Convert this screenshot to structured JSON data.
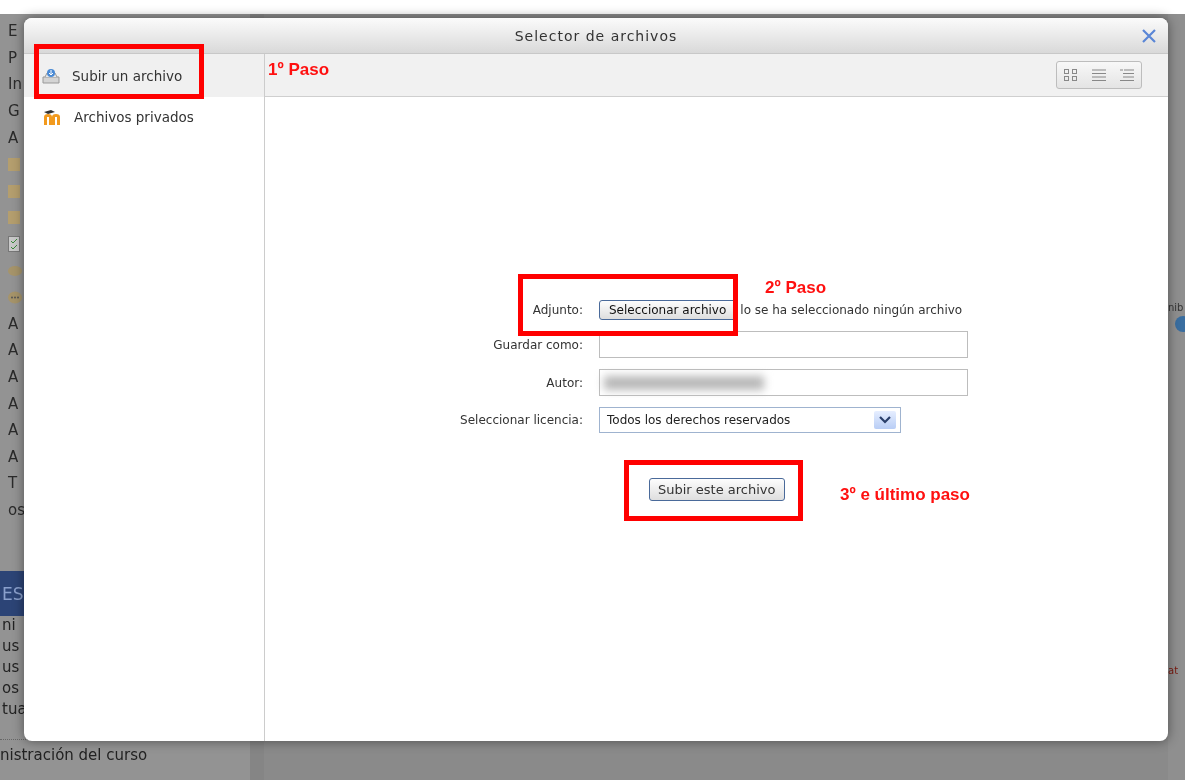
{
  "backdrop": {
    "left_items": [
      {
        "kind": "text",
        "text": "E"
      },
      {
        "kind": "text",
        "text": "P"
      },
      {
        "kind": "text",
        "text": "In"
      },
      {
        "kind": "text",
        "text": "G"
      },
      {
        "kind": "text",
        "text": "A"
      },
      {
        "kind": "folder"
      },
      {
        "kind": "folder"
      },
      {
        "kind": "folder"
      },
      {
        "kind": "check"
      },
      {
        "kind": "oval"
      },
      {
        "kind": "chat"
      },
      {
        "kind": "text",
        "text": "A"
      },
      {
        "kind": "text",
        "text": "A"
      },
      {
        "kind": "text",
        "text": "A"
      },
      {
        "kind": "text",
        "text": "A"
      },
      {
        "kind": "text",
        "text": "A"
      },
      {
        "kind": "text",
        "text": "A"
      },
      {
        "kind": "text",
        "text": "T"
      },
      {
        "kind": "text",
        "text": "os"
      }
    ],
    "block_header": "ES",
    "block_items": [
      "ni",
      "us",
      "us",
      "os",
      "tua"
    ],
    "footer_link": "nistración del curso",
    "right_texts": [
      {
        "kind": "text",
        "text": "nib"
      },
      {
        "kind": "help"
      },
      {
        "kind": "alert",
        "text": "at"
      }
    ]
  },
  "dialog": {
    "title": "Selector de archivos",
    "sidebar": [
      {
        "kind": "upload",
        "label": "Subir un archivo",
        "selected": true
      },
      {
        "kind": "moodle",
        "label": "Archivos privados",
        "selected": false
      }
    ],
    "views": [
      {
        "kind": "icons",
        "selected": false
      },
      {
        "kind": "list",
        "selected": false
      },
      {
        "kind": "tree",
        "selected": false
      }
    ],
    "form": {
      "attachment_label": "Adjunto:",
      "choose_button": "Seleccionar archivo",
      "no_file_text": "lo se ha seleccionado ningún archivo",
      "save_as_label": "Guardar como:",
      "author_label": "Autor:",
      "license_label": "Seleccionar licencia:",
      "license_value": "Todos los derechos reservados",
      "upload_button": "Subir este archivo"
    }
  },
  "annotations": [
    {
      "text": "1º Paso"
    },
    {
      "text": "2º Paso"
    },
    {
      "text": "3º e último paso"
    }
  ]
}
